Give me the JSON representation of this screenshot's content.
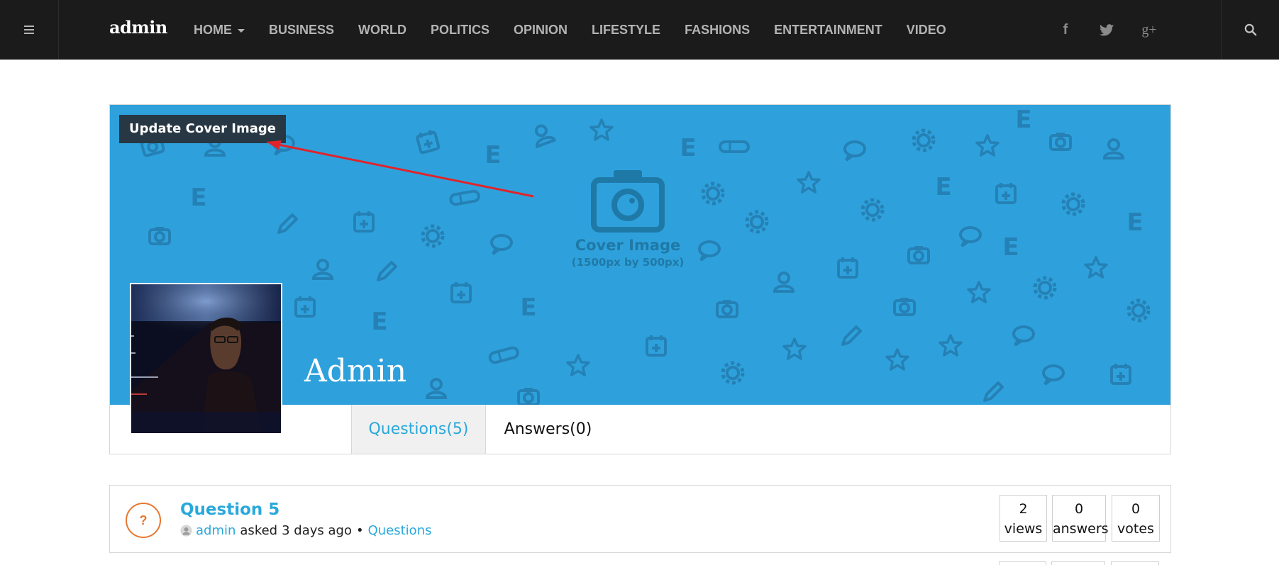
{
  "navbar": {
    "menu_icon": "hamburger-icon",
    "brand": "admin",
    "links": [
      {
        "label": "HOME",
        "dropdown": true
      },
      {
        "label": "BUSINESS"
      },
      {
        "label": "WORLD"
      },
      {
        "label": "POLITICS"
      },
      {
        "label": "OPINION"
      },
      {
        "label": "LIFESTYLE"
      },
      {
        "label": "FASHIONS"
      },
      {
        "label": "ENTERTAINMENT"
      },
      {
        "label": "VIDEO"
      }
    ],
    "social": {
      "facebook": "f",
      "twitter_icon": "twitter-icon",
      "googleplus": "g+"
    },
    "search_icon": "search-icon"
  },
  "profile": {
    "update_cover_label": "Update Cover Image",
    "cover_placeholder_title": "Cover Image",
    "cover_placeholder_dims": "(1500px by 500px)",
    "name": "Admin",
    "tabs": [
      {
        "label": "Questions(5)",
        "active": true
      },
      {
        "label": "Answers(0)",
        "active": false
      }
    ]
  },
  "questions": [
    {
      "icon": "?",
      "title": "Question 5",
      "author": "admin",
      "action": "asked",
      "time": "3 days ago",
      "separator": "•",
      "category": "Questions",
      "stats": {
        "views": {
          "value": "2",
          "label": "views"
        },
        "answers": {
          "value": "0",
          "label": "answers"
        },
        "votes": {
          "value": "0",
          "label": "votes"
        }
      }
    }
  ],
  "colors": {
    "nav_bg": "#1b1b1b",
    "cover_bg": "#2ea1dc",
    "accent": "#29a8dc",
    "question_icon": "#e8772e",
    "annotation_arrow": "#e0242a"
  }
}
